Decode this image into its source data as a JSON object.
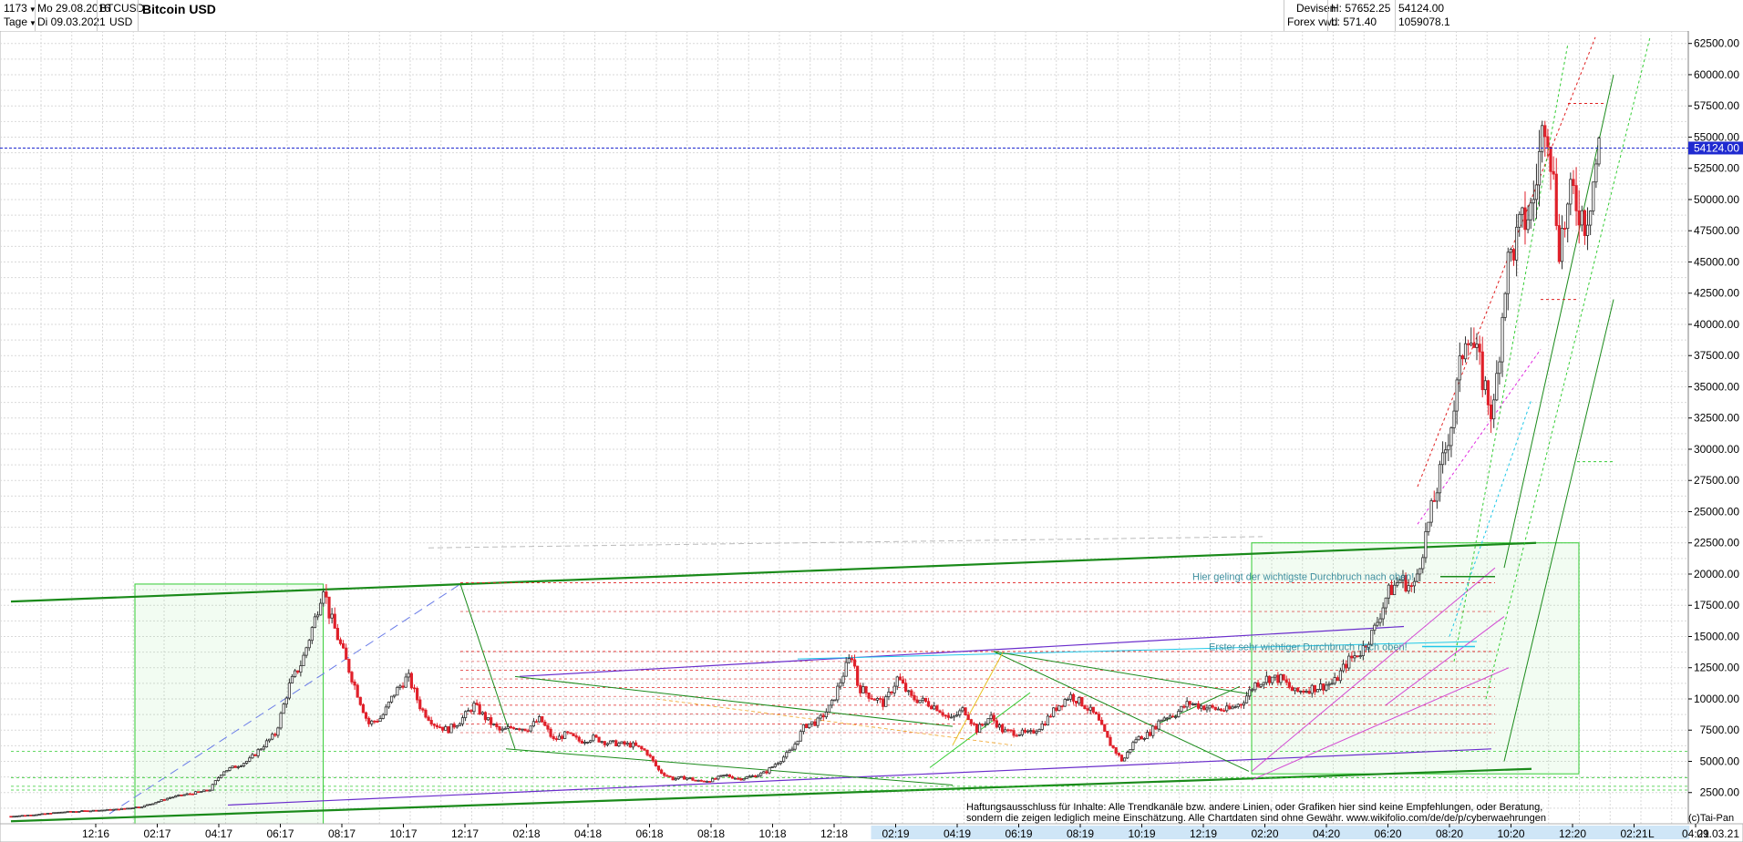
{
  "header": {
    "count": "1173",
    "period": "Tage",
    "date_from": "Mo 29.08.2016",
    "date_to": "Di 09.03.2021",
    "symbol": "BTCUSD",
    "currency": "USD",
    "title": "Bitcoin USD",
    "market": "Devisen",
    "source": "Forex vwd",
    "high_label": "H: 57652.25",
    "low_label": "L: 571.40",
    "last_value": "54124.00",
    "volume_value": "1059078.1"
  },
  "colors": {
    "up": "#2f2f2f",
    "down": "#e0202a",
    "trend_green": "#1a8a1a",
    "light_green": "#33cc33",
    "purple": "#6a2dcc",
    "magenta": "#e028e0",
    "red_dash": "#e02020",
    "cyan": "#20c8e8",
    "price_line": "#1f2ad0",
    "grid": "#d9d9d9"
  },
  "chart_data": {
    "type": "candlestick",
    "title": "Bitcoin USD",
    "ylim": [
      0,
      63500
    ],
    "y_ticks": [
      2500,
      5000,
      7500,
      10000,
      12500,
      15000,
      17500,
      20000,
      22500,
      25000,
      27500,
      30000,
      32500,
      35000,
      37500,
      40000,
      42500,
      45000,
      47500,
      50000,
      52500,
      55000,
      57500,
      60000,
      62500
    ],
    "y_tick_labels": [
      "2500.00",
      "5000.00",
      "7500.00",
      "10000.00",
      "12500.00",
      "15000.00",
      "17500.00",
      "20000.00",
      "22500.00",
      "25000.00",
      "27500.00",
      "30000.00",
      "32500.00",
      "35000.00",
      "37500.00",
      "40000.00",
      "42500.00",
      "45000.00",
      "47500.00",
      "50000.00",
      "52500.00",
      "55000.00",
      "57500.00",
      "60000.00",
      "62500.00"
    ],
    "x_tick_labels": [
      "12:16",
      "02:17",
      "04:17",
      "06:17",
      "08:17",
      "10:17",
      "12:17",
      "02:18",
      "04:18",
      "06:18",
      "08:18",
      "10:18",
      "12:18",
      "02:19",
      "04:19",
      "06:19",
      "08:19",
      "10:19",
      "12:19",
      "02:20",
      "04:20",
      "06:20",
      "08:20",
      "10:20",
      "12:20",
      "02:21",
      "04:21"
    ],
    "last_date": "09.03.21",
    "last_price": 54124.0,
    "high": 57652.25,
    "low": 571.4,
    "price_path": [
      [
        0,
        600
      ],
      [
        2,
        750
      ],
      [
        4,
        950
      ],
      [
        6,
        1050
      ],
      [
        8,
        1150
      ],
      [
        10,
        1400
      ],
      [
        12,
        2100
      ],
      [
        14,
        2500
      ],
      [
        15,
        2700
      ],
      [
        16,
        4200
      ],
      [
        17,
        4600
      ],
      [
        18,
        5100
      ],
      [
        19,
        6200
      ],
      [
        20,
        7200
      ],
      [
        21,
        11000
      ],
      [
        22,
        13000
      ],
      [
        23,
        16500
      ],
      [
        23.6,
        19200
      ],
      [
        24,
        17000
      ],
      [
        25,
        14000
      ],
      [
        26,
        11000
      ],
      [
        27,
        8000
      ],
      [
        28,
        8500
      ],
      [
        29,
        10500
      ],
      [
        30,
        11800
      ],
      [
        31,
        9200
      ],
      [
        32,
        8000
      ],
      [
        33,
        7500
      ],
      [
        34,
        8300
      ],
      [
        35,
        9500
      ],
      [
        36,
        8300
      ],
      [
        37,
        7400
      ],
      [
        38,
        7800
      ],
      [
        39,
        7600
      ],
      [
        40,
        8400
      ],
      [
        41,
        6700
      ],
      [
        42,
        7200
      ],
      [
        43,
        6600
      ],
      [
        44,
        6900
      ],
      [
        45,
        6500
      ],
      [
        46,
        6400
      ],
      [
        47,
        6300
      ],
      [
        48,
        5800
      ],
      [
        49,
        4200
      ],
      [
        50,
        3600
      ],
      [
        51,
        3700
      ],
      [
        52,
        3400
      ],
      [
        53,
        3500
      ],
      [
        54,
        3900
      ],
      [
        55,
        3600
      ],
      [
        56,
        3800
      ],
      [
        57,
        4100
      ],
      [
        58,
        5000
      ],
      [
        59,
        5900
      ],
      [
        60,
        7900
      ],
      [
        61,
        8200
      ],
      [
        62,
        9500
      ],
      [
        63,
        12300
      ],
      [
        63.6,
        13600
      ],
      [
        64,
        11000
      ],
      [
        65,
        10200
      ],
      [
        66,
        9600
      ],
      [
        67,
        11700
      ],
      [
        68,
        10100
      ],
      [
        69,
        9800
      ],
      [
        70,
        9300
      ],
      [
        71,
        8300
      ],
      [
        72,
        9200
      ],
      [
        73,
        7500
      ],
      [
        74,
        8600
      ],
      [
        75,
        7400
      ],
      [
        76,
        7300
      ],
      [
        77,
        7200
      ],
      [
        78,
        8000
      ],
      [
        79,
        9300
      ],
      [
        80,
        10300
      ],
      [
        81,
        9600
      ],
      [
        82,
        8600
      ],
      [
        83,
        6500
      ],
      [
        84,
        5000
      ],
      [
        85,
        6800
      ],
      [
        86,
        7200
      ],
      [
        87,
        8500
      ],
      [
        88,
        8800
      ],
      [
        89,
        9700
      ],
      [
        90,
        9400
      ],
      [
        91,
        9200
      ],
      [
        92,
        9100
      ],
      [
        93,
        9700
      ],
      [
        94,
        11200
      ],
      [
        95,
        11700
      ],
      [
        96,
        11600
      ],
      [
        97,
        10500
      ],
      [
        98,
        10800
      ],
      [
        99,
        11000
      ],
      [
        100,
        11300
      ],
      [
        101,
        13000
      ],
      [
        102,
        13800
      ],
      [
        103,
        15500
      ],
      [
        104,
        18400
      ],
      [
        105,
        19600
      ],
      [
        106,
        18800
      ],
      [
        107,
        23500
      ],
      [
        108,
        28000
      ],
      [
        109,
        33000
      ],
      [
        110,
        40000
      ],
      [
        111,
        36500
      ],
      [
        112,
        32500
      ],
      [
        113,
        44500
      ],
      [
        114,
        47500
      ],
      [
        115,
        49500
      ],
      [
        116,
        57500
      ],
      [
        117,
        46500
      ],
      [
        118,
        50500
      ],
      [
        119,
        48200
      ],
      [
        120,
        54124
      ]
    ],
    "annotations": [
      "Hier gelingt der wichtigste Durchbruch nach oben!",
      "Erster sehr wichtiger Durchbruch nach oben!"
    ],
    "disclaimer_line1": "Haftungsausschluss für Inhalte: Alle Trendkanäle bzw. andere Linien, oder Grafiken hier sind keine Empfehlungen, oder Beratung,",
    "disclaimer_line2": "sondern die zeigen lediglich meine  Einschätzung. Alle Chartdaten sind ohne Gewähr.  www.wikifolio.com/de/de/p/cyberwaehrungen",
    "copyright": "(c)Tai-Pan",
    "scale_marker": "L"
  }
}
